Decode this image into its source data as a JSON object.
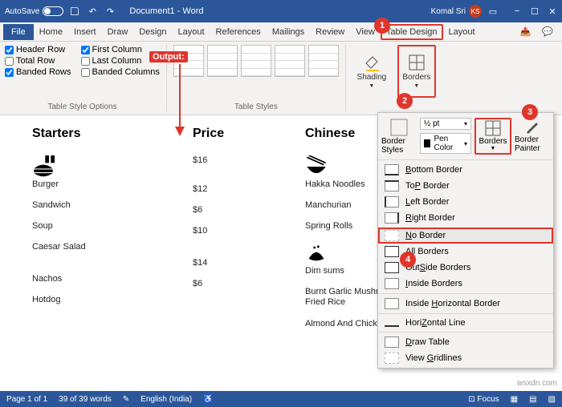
{
  "titlebar": {
    "autosave": "AutoSave",
    "doc": "Document1 - Word",
    "user": "Komal Sri",
    "initials": "KS"
  },
  "tabs": {
    "file": "File",
    "home": "Home",
    "insert": "Insert",
    "draw": "Draw",
    "design": "Design",
    "layout": "Layout",
    "references": "References",
    "mailings": "Mailings",
    "review": "Review",
    "view": "View",
    "tableDesign": "Table Design",
    "layout2": "Layout"
  },
  "ribbon": {
    "headerRow": "Header Row",
    "firstCol": "First Column",
    "totalRow": "Total Row",
    "lastCol": "Last Column",
    "bandedRows": "Banded Rows",
    "bandedCols": "Banded Columns",
    "tso": "Table Style Options",
    "ts": "Table Styles",
    "shading": "Shading",
    "borders": "Borders"
  },
  "output": "Output:",
  "doc": {
    "h1": "Starters",
    "h2": "Price",
    "h3": "Chinese",
    "c1": [
      "Burger",
      "Sandwich",
      "Soup",
      "Caesar Salad",
      "Nachos",
      "Hotdog"
    ],
    "c2": [
      "$16",
      "$12",
      "$6",
      "$10",
      "$14",
      "$6"
    ],
    "c3": [
      "Hakka Noodles",
      "Manchurian",
      "Spring Rolls",
      "Dim sums",
      "Burnt Garlic Mushroom Fried Rice",
      "Almond And Chicken"
    ]
  },
  "popup": {
    "borderStyles": "Border Styles",
    "weight": "½ pt",
    "penColor": "Pen Color",
    "borders": "Borders",
    "painter": "Border Painter",
    "items": [
      "Bottom Border",
      "Top Border",
      "Left Border",
      "Right Border",
      "No Border",
      "All Borders",
      "Outside Borders",
      "Inside Borders",
      "Inside Horizontal Border",
      "Horizontal Line",
      "Draw Table",
      "View Gridlines"
    ],
    "accel": [
      "B",
      "P",
      "L",
      "R",
      "N",
      "A",
      "S",
      "I",
      "H",
      "Z",
      "D",
      "G"
    ]
  },
  "status": {
    "page": "Page 1 of 1",
    "words": "39 of 39 words",
    "lang": "English (India)",
    "focus": "Focus"
  },
  "badges": {
    "b1": "1",
    "b2": "2",
    "b3": "3",
    "b4": "4"
  },
  "watermark": "wsxdn.com"
}
